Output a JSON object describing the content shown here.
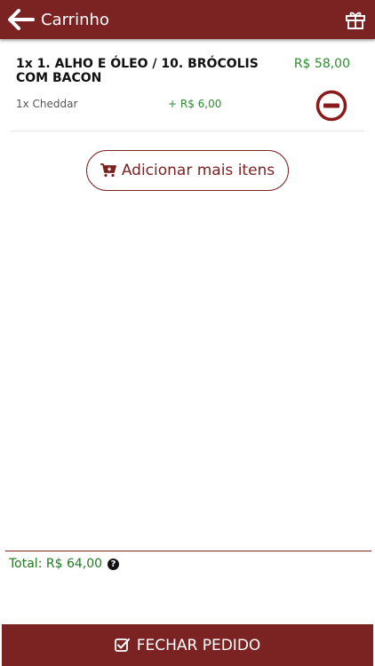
{
  "header": {
    "title": "Carrinho",
    "back_icon": "arrow-left-icon",
    "gift_icon": "gift-icon"
  },
  "cart": {
    "items": [
      {
        "quantity_name": "1x 1. ALHO E ÓLEO / 10. BRÓCOLIS COM BACON",
        "price": "R$ 58,00",
        "addon_name": "1x Cheddar",
        "addon_price": "+ R$ 6,00",
        "remove_icon": "minus-circle-icon"
      }
    ],
    "add_more_label": "Adicionar mais itens",
    "add_more_icon": "cart-plus-icon"
  },
  "footer": {
    "total_label": "Total: R$ 64,00",
    "help_icon": "question-circle-icon",
    "checkout_label": "FECHAR PEDIDO",
    "checkout_icon": "check-square-icon"
  },
  "colors": {
    "brand": "#7b2323",
    "price_green": "#2e8b2e"
  }
}
